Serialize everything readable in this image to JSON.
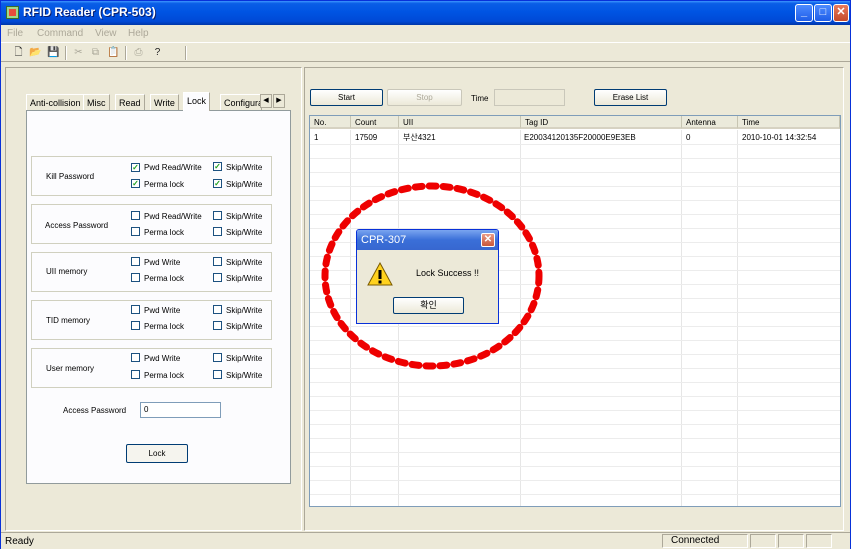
{
  "window": {
    "title": "RFID Reader (CPR-503)"
  },
  "menu": [
    "File",
    "Command",
    "View",
    "Help"
  ],
  "toolbar": {
    "icons": [
      "new-file-icon",
      "open-folder-icon",
      "save-icon",
      "cut-icon",
      "copy-icon",
      "paste-icon",
      "print-icon",
      "help-icon"
    ]
  },
  "tabs": {
    "items": [
      "Anti-collision",
      "Misc",
      "Read",
      "Write",
      "Lock",
      "Configura"
    ],
    "active": "Lock"
  },
  "lock_panel": {
    "groups": [
      {
        "label": "Kill Password",
        "opt1": "Pwd Read/Write",
        "opt2": "Skip/Write",
        "opt3": "Perma lock",
        "opt4": "Skip/Write",
        "checked": [
          true,
          true,
          true,
          true
        ]
      },
      {
        "label": "Access Password",
        "opt1": "Pwd Read/Write",
        "opt2": "Skip/Write",
        "opt3": "Perma lock",
        "opt4": "Skip/Write",
        "checked": [
          false,
          false,
          false,
          false
        ]
      },
      {
        "label": "UII memory",
        "opt1": "Pwd Write",
        "opt2": "Skip/Write",
        "opt3": "Perma lock",
        "opt4": "Skip/Write",
        "checked": [
          false,
          false,
          false,
          false
        ]
      },
      {
        "label": "TID memory",
        "opt1": "Pwd Write",
        "opt2": "Skip/Write",
        "opt3": "Perma lock",
        "opt4": "Skip/Write",
        "checked": [
          false,
          false,
          false,
          false
        ]
      },
      {
        "label": "User memory",
        "opt1": "Pwd Write",
        "opt2": "Skip/Write",
        "opt3": "Perma lock",
        "opt4": "Skip/Write",
        "checked": [
          false,
          false,
          false,
          false
        ]
      }
    ],
    "access_password_label": "Access Password",
    "access_password_value": "0",
    "lock_button": "Lock"
  },
  "controls": {
    "start": "Start",
    "stop": "Stop",
    "time_label": "Time",
    "time_value": "",
    "erase": "Erase List"
  },
  "table": {
    "columns": [
      "No.",
      "Count",
      "UII",
      "Tag ID",
      "Antenna",
      "Time"
    ],
    "rows": [
      [
        "1",
        "17509",
        "부산4321",
        "E20034120135F20000E9E3EB",
        "0",
        "2010-10-01 14:32:54"
      ]
    ]
  },
  "dialog": {
    "title": "CPR-307",
    "message": "Lock Success !!",
    "ok": "확인",
    "icon": "warning-icon"
  },
  "annotation": {
    "color": "#ee0000",
    "shape": "dashed-ellipse"
  },
  "status": {
    "left": "Ready",
    "connection": "Connected"
  }
}
